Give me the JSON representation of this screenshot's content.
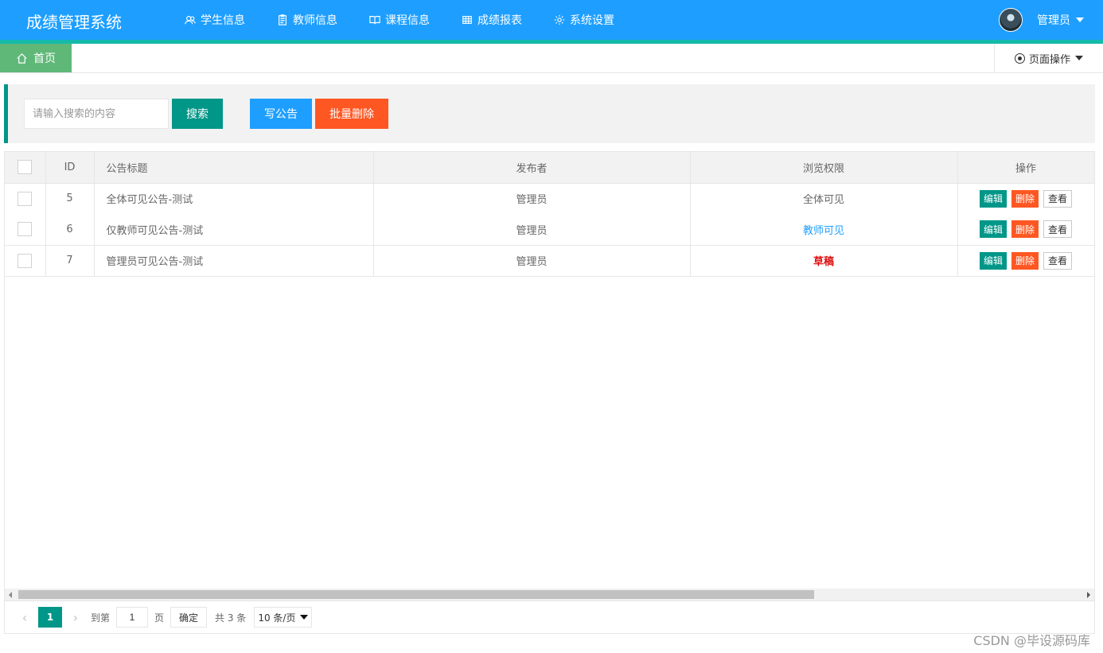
{
  "app": {
    "title": "成绩管理系统"
  },
  "nav": [
    {
      "label": "学生信息",
      "icon": "users-icon"
    },
    {
      "label": "教师信息",
      "icon": "clipboard-icon"
    },
    {
      "label": "课程信息",
      "icon": "book-icon"
    },
    {
      "label": "成绩报表",
      "icon": "table-icon"
    },
    {
      "label": "系统设置",
      "icon": "gear-icon"
    }
  ],
  "user": {
    "name": "管理员"
  },
  "tabs": {
    "home": "首页",
    "page_ops": "页面操作"
  },
  "toolbar": {
    "search_placeholder": "请输入搜索的内容",
    "search_label": "搜索",
    "write_label": "写公告",
    "batch_delete_label": "批量删除"
  },
  "table": {
    "headers": {
      "id": "ID",
      "title": "公告标题",
      "publisher": "发布者",
      "permission": "浏览权限",
      "ops": "操作"
    },
    "rows": [
      {
        "id": "5",
        "title": "全体可见公告-测试",
        "publisher": "管理员",
        "permission": "全体可见"
      },
      {
        "id": "6",
        "title": "仅教师可见公告-测试",
        "publisher": "管理员",
        "permission": "教师可见"
      },
      {
        "id": "7",
        "title": "管理员可见公告-测试",
        "publisher": "管理员",
        "permission": "草稿"
      }
    ],
    "ops": {
      "edit": "编辑",
      "delete": "删除",
      "view": "查看"
    }
  },
  "pager": {
    "current": "1",
    "goto_label": "到第",
    "goto_value": "1",
    "page_unit": "页",
    "confirm": "确定",
    "total": "共 3 条",
    "page_size": "10 条/页"
  },
  "colors": {
    "primary": "#1e9fff",
    "teal": "#009688",
    "orange": "#ff5722",
    "green": "#5fb878"
  },
  "watermark": "CSDN @毕设源码库"
}
